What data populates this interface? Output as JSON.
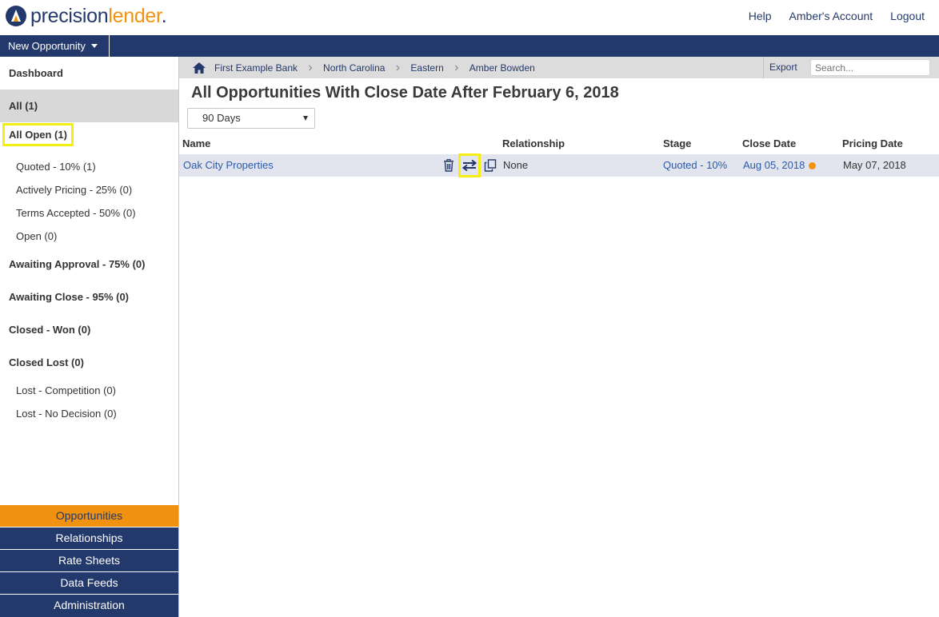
{
  "brand": {
    "precision": "precision",
    "lender": "lender",
    "dot": ".",
    "accent": "#f0920f",
    "primary": "#24396b"
  },
  "header": {
    "links": [
      "Help",
      "Amber's Account",
      "Logout"
    ]
  },
  "navbar": {
    "new_opportunity": "New Opportunity"
  },
  "sidebar": {
    "items": [
      {
        "label": "Dashboard"
      },
      {
        "label": "All (1)"
      },
      {
        "label": "All Open (1)"
      },
      {
        "label": "Quoted - 10% (1)"
      },
      {
        "label": "Actively Pricing - 25% (0)"
      },
      {
        "label": "Terms Accepted - 50% (0)"
      },
      {
        "label": "Open (0)"
      },
      {
        "label": "Awaiting Approval - 75% (0)"
      },
      {
        "label": "Awaiting Close - 95% (0)"
      },
      {
        "label": "Closed - Won (0)"
      },
      {
        "label": "Closed Lost (0)"
      },
      {
        "label": "Lost - Competition (0)"
      },
      {
        "label": "Lost - No Decision (0)"
      }
    ]
  },
  "bottom_nav": [
    "Opportunities",
    "Relationships",
    "Rate Sheets",
    "Data Feeds",
    "Administration"
  ],
  "breadcrumb": [
    "First Example Bank",
    "North Carolina",
    "Eastern",
    "Amber Bowden"
  ],
  "toolbar": {
    "export": "Export",
    "search_placeholder": "Search..."
  },
  "main": {
    "title": "All Opportunities With Close Date After February 6, 2018",
    "filter_value": "90 Days"
  },
  "table": {
    "headers": [
      "Name",
      "Relationship",
      "Stage",
      "Close Date",
      "Pricing Date"
    ],
    "rows": [
      {
        "name": "Oak City Properties",
        "relationship": "None",
        "stage": "Quoted - 10%",
        "close_date": "Aug 05, 2018",
        "pricing_date": "May 07, 2018"
      }
    ]
  }
}
